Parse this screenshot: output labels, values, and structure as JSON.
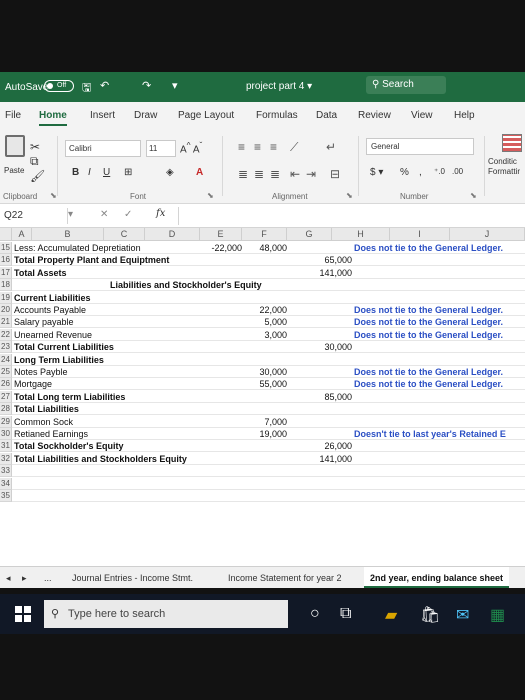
{
  "titlebar": {
    "autosave": "AutoSave",
    "autosave_state": "Off",
    "doc_title": "project part 4",
    "search": "Search"
  },
  "ribbon": {
    "tabs": [
      "File",
      "Home",
      "Insert",
      "Draw",
      "Page Layout",
      "Formulas",
      "Data",
      "Review",
      "View",
      "Help"
    ],
    "font_name": "Calibri",
    "font_size": "11",
    "number_format": "General",
    "paste": "Paste",
    "conditional": "Conditic Formattir",
    "groups": [
      "Clipboard",
      "Font",
      "Alignment",
      "Number"
    ]
  },
  "formula": {
    "namebox": "Q22",
    "fx": "fx"
  },
  "grid": {
    "columns": [
      "A",
      "B",
      "C",
      "D",
      "E",
      "F",
      "G",
      "H",
      "I",
      "J"
    ],
    "rows": [
      {
        "n": "15",
        "label": "Less: Accumulated Depretiation",
        "bold": false,
        "e": "-22,000",
        "f": "48,000",
        "g": "",
        "h": "Does not tie to the General Ledger."
      },
      {
        "n": "16",
        "label": "Total Property Plant and Equiptment",
        "bold": true,
        "e": "",
        "f": "",
        "g": "65,000",
        "h": ""
      },
      {
        "n": "17",
        "label": "Total Assets",
        "bold": true,
        "e": "",
        "f": "",
        "g": "141,000",
        "h": ""
      },
      {
        "n": "18",
        "label": "",
        "bold": false,
        "e": "",
        "f": "",
        "g": "",
        "h": "",
        "center": "Liabilities and Stockholder's Equity"
      },
      {
        "n": "19",
        "label": "Current Liabilities",
        "bold": true,
        "e": "",
        "f": "",
        "g": "",
        "h": ""
      },
      {
        "n": "20",
        "label": "Accounts Payable",
        "bold": false,
        "e": "",
        "f": "22,000",
        "g": "",
        "h": "Does not tie to the General Ledger."
      },
      {
        "n": "21",
        "label": "Salary payable",
        "bold": false,
        "e": "",
        "f": "5,000",
        "g": "",
        "h": "Does not tie to the General Ledger."
      },
      {
        "n": "22",
        "label": "Unearned Revenue",
        "bold": false,
        "e": "",
        "f": "3,000",
        "g": "",
        "h": "Does not tie to the General Ledger."
      },
      {
        "n": "23",
        "label": "Total Current Liabilities",
        "bold": true,
        "e": "",
        "f": "",
        "g": "30,000",
        "h": ""
      },
      {
        "n": "24",
        "label": "Long Term Liabilities",
        "bold": true,
        "e": "",
        "f": "",
        "g": "",
        "h": ""
      },
      {
        "n": "25",
        "label": "Notes Payble",
        "bold": false,
        "e": "",
        "f": "30,000",
        "g": "",
        "h": "Does not tie to the General Ledger."
      },
      {
        "n": "26",
        "label": "Mortgage",
        "bold": false,
        "e": "",
        "f": "55,000",
        "g": "",
        "h": "Does not tie to the General Ledger."
      },
      {
        "n": "27",
        "label": "Total Long term Liabilities",
        "bold": true,
        "e": "",
        "f": "",
        "g": "85,000",
        "h": ""
      },
      {
        "n": "28",
        "label": "Total Liabilities",
        "bold": true,
        "e": "",
        "f": "",
        "g": "",
        "h": ""
      },
      {
        "n": "29",
        "label": "Common Sock",
        "bold": false,
        "e": "",
        "f": "7,000",
        "g": "",
        "h": ""
      },
      {
        "n": "30",
        "label": "Retianed Earnings",
        "bold": false,
        "e": "",
        "f": "19,000",
        "g": "",
        "h": "Doesn't tie to last year's Retained E"
      },
      {
        "n": "31",
        "label": "Total Sockholder's Equity",
        "bold": true,
        "e": "",
        "f": "",
        "g": "26,000",
        "h": ""
      },
      {
        "n": "32",
        "label": "Total Liabilities and Stockholders Equity",
        "bold": true,
        "e": "",
        "f": "",
        "g": "141,000",
        "h": ""
      },
      {
        "n": "33",
        "label": "",
        "bold": false,
        "e": "",
        "f": "",
        "g": "",
        "h": ""
      },
      {
        "n": "34",
        "label": "",
        "bold": false,
        "e": "",
        "f": "",
        "g": "",
        "h": ""
      },
      {
        "n": "35",
        "label": "",
        "bold": false,
        "e": "",
        "f": "",
        "g": "",
        "h": ""
      }
    ]
  },
  "sheets": {
    "more": "...",
    "items": [
      "Journal Entries - Income Stmt.",
      "Income Statement for year 2",
      "2nd year, ending balance sheet"
    ]
  },
  "taskbar": {
    "search_placeholder": "Type here to search"
  },
  "colors": {
    "excel_green": "#1f6b40",
    "highlight_blue": "#2b4fc4"
  }
}
